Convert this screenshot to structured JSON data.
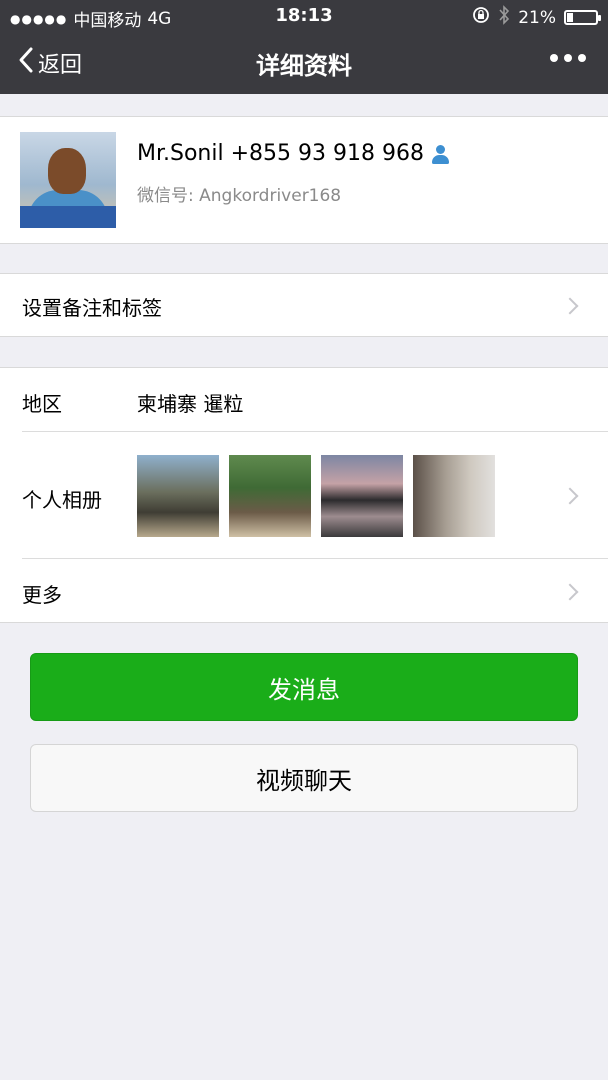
{
  "status_bar": {
    "signal_dots": "●●●●●",
    "carrier": "中国移动",
    "network": "4G",
    "time": "18:13",
    "battery_text": "21%",
    "battery_level": 0.21,
    "icons": [
      "orientation-lock-icon",
      "bluetooth-icon",
      "battery-icon"
    ]
  },
  "nav": {
    "back_label": "返回",
    "title": "详细资料",
    "more_icon": "more-icon"
  },
  "profile": {
    "name": "Mr.Sonil +855 93 918 968",
    "name_icon": "person-icon",
    "wechat_id_label": "微信号:",
    "wechat_id": "Angkordriver168"
  },
  "remark_row": {
    "label": "设置备注和标签"
  },
  "region_row": {
    "label": "地区",
    "value": "柬埔寨 暹粒"
  },
  "album_row": {
    "label": "个人相册"
  },
  "more_row": {
    "label": "更多"
  },
  "buttons": {
    "message": "发消息",
    "video_call": "视频聊天"
  },
  "colors": {
    "nav_bg": "#3a3a3f",
    "page_bg": "#efeff4",
    "primary_green": "#1aad19",
    "subtle_text": "#8a8a8a"
  }
}
